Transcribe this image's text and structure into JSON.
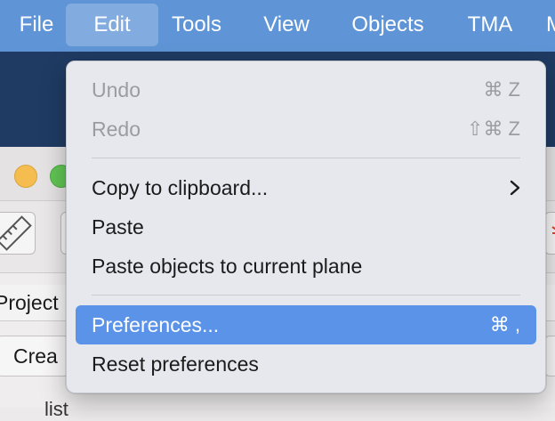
{
  "menubar": {
    "items": [
      {
        "label": "File"
      },
      {
        "label": "Edit"
      },
      {
        "label": "Tools"
      },
      {
        "label": "View"
      },
      {
        "label": "Objects"
      },
      {
        "label": "TMA"
      },
      {
        "label": "M"
      }
    ]
  },
  "background": {
    "tab_label": "Project",
    "create_label": "Crea",
    "bottom_text": "list"
  },
  "edit_menu": {
    "items": [
      {
        "label": "Undo",
        "shortcut": "⌘ Z",
        "enabled": false
      },
      {
        "label": "Redo",
        "shortcut": "⇧⌘ Z",
        "enabled": false
      },
      {
        "label": "Copy to clipboard...",
        "submenu": true,
        "enabled": true
      },
      {
        "label": "Paste",
        "enabled": true
      },
      {
        "label": "Paste objects to current plane",
        "enabled": true
      },
      {
        "label": "Preferences...",
        "shortcut": "⌘ ,",
        "enabled": true,
        "highlighted": true
      },
      {
        "label": "Reset preferences",
        "enabled": true
      }
    ]
  },
  "colors": {
    "menubar": "#5f95d6",
    "highlight": "#5b93e8",
    "traffic_yellow": "#f5bd4f",
    "traffic_green": "#61c554"
  }
}
